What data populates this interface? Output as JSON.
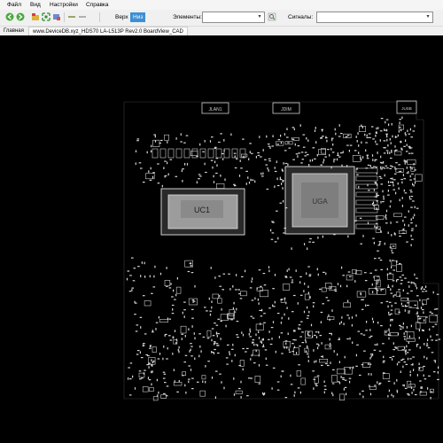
{
  "menu": {
    "file": "Файл",
    "view": "Вид",
    "settings": "Настройки",
    "help": "Справка"
  },
  "toolbar": {
    "side_top": "Верх",
    "side_bottom": "Низ",
    "elements_label": "Элементы:",
    "elements_value": "",
    "signals_label": "Сигналы:",
    "signals_value": ""
  },
  "tabs": [
    {
      "label": "Главная"
    },
    {
      "label": "www.DeviceDB.xyz_HDS70 LA-L513P Rev2.0 BoardView_CAD"
    }
  ],
  "board": {
    "chip1_label": "UC1",
    "chip2_label": "UGA",
    "conn1_label": "JLAN1",
    "conn2_label": "JDIM",
    "conn3_label": "JUSB"
  },
  "colors": {
    "accent": "#3c8fd6",
    "pcb_bg": "#000000",
    "component": "#cfcfcf"
  }
}
